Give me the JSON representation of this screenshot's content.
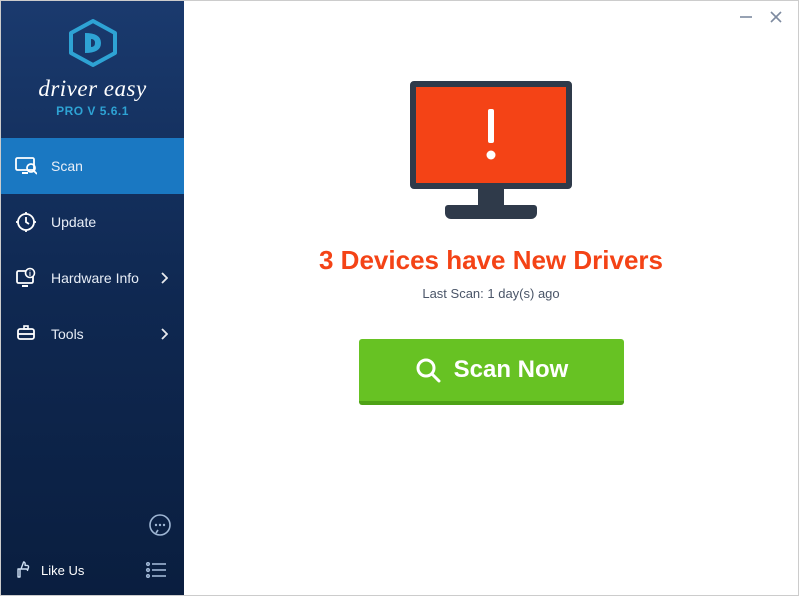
{
  "app": {
    "brand_name": "driver easy",
    "version_label": "PRO V 5.6.1"
  },
  "sidebar": {
    "items": [
      {
        "label": "Scan",
        "active": true,
        "has_chevron": false
      },
      {
        "label": "Update",
        "active": false,
        "has_chevron": false
      },
      {
        "label": "Hardware Info",
        "active": false,
        "has_chevron": true
      },
      {
        "label": "Tools",
        "active": false,
        "has_chevron": true
      }
    ],
    "like_label": "Like Us"
  },
  "main": {
    "headline": "3 Devices have New Drivers",
    "last_scan": "Last Scan: 1 day(s) ago",
    "scan_button": "Scan Now"
  },
  "colors": {
    "accent_red": "#f44316",
    "accent_green": "#67c223",
    "sidebar_active": "#1a78c2"
  }
}
